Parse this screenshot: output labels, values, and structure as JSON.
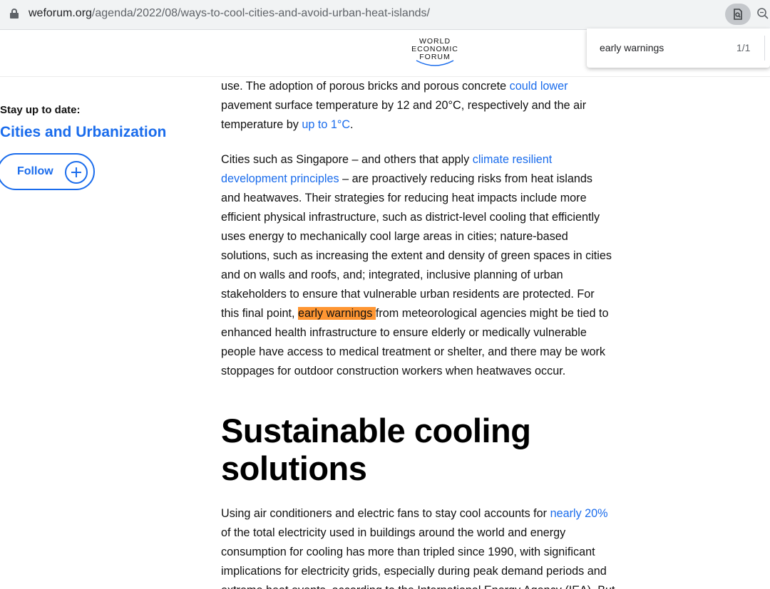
{
  "browser": {
    "url_domain": "weforum.org",
    "url_path": "/agenda/2022/08/ways-to-cool-cities-and-avoid-urban-heat-islands/"
  },
  "find": {
    "query": "early warnings",
    "count": "1/1"
  },
  "logo": {
    "line1": "WORLD",
    "line2": "ECONOMIC",
    "line3": "FORUM"
  },
  "sidebar": {
    "stay_label": "Stay up to date:",
    "topic": "Cities and Urbanization",
    "follow_label": "Follow"
  },
  "article": {
    "p1": {
      "l1_a": "use. The adoption of porous bricks and porous concrete ",
      "l1_link": "could lower",
      "l2": "pavement surface temperature by 12 and 20°C, respectively and the air",
      "l3_a": "temperature by ",
      "l3_link": "up to 1°C",
      "l3_b": "."
    },
    "p2": {
      "l1_a": "Cities such as Singapore – and others that apply ",
      "l1_link": "climate resilient",
      "l2_link": "development principles",
      "l2_b": " – are proactively reducing risks from heat islands",
      "l3": "and heatwaves. Their strategies for reducing heat impacts include more",
      "l4": "efficient physical infrastructure, such as district-level cooling that efficiently",
      "l5": "uses energy to mechanically cool large areas in cities; nature-based",
      "l6": "solutions, such as increasing the extent and density of green spaces in cities",
      "l7": "and on walls and roofs, and; integrated, inclusive planning of urban",
      "l8": "stakeholders to ensure that vulnerable urban residents are protected. For",
      "l9_a": "this final point, ",
      "l9_hl": "early warnings ",
      "l9_b": "from meteorological agencies might be tied to",
      "l10": "enhanced health infrastructure to ensure elderly or medically vulnerable",
      "l11": "people have access to medical treatment or shelter, and there may be work",
      "l12": "stoppages for outdoor construction workers when heatwaves occur."
    },
    "heading_l1": "Sustainable cooling",
    "heading_l2": "solutions",
    "p3": {
      "l1_a": "Using air conditioners and electric fans to stay cool accounts for ",
      "l1_link": "nearly 20%",
      "l2": "of the total electricity used in buildings around the world and energy",
      "l3": "consumption for cooling has more than tripled since 1990, with significant",
      "l4": "implications for electricity grids, especially during peak demand periods and",
      "l5": "extreme heat events, according to the International Energy Agency (IEA). But"
    }
  },
  "colors": {
    "link": "#1a6cec",
    "highlight": "#ff9632"
  },
  "icons": [
    "lock-icon",
    "find-in-page-icon",
    "zoom-icon",
    "plus-icon"
  ]
}
